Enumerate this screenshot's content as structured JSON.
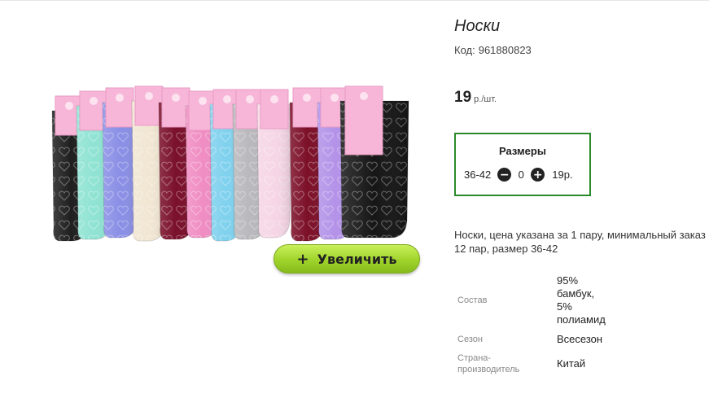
{
  "product": {
    "title": "Носки",
    "code_label": "Код:",
    "code_value": "961880823",
    "price_value": "19",
    "price_unit": "р./шт."
  },
  "sizes": {
    "heading": "Размеры",
    "size": "36-42",
    "minus_icon": "minus-circle-icon",
    "quantity": "0",
    "plus_icon": "plus-circle-icon",
    "price": "19р.",
    "border_color": "#2a8a2a"
  },
  "zoom_button": {
    "icon": "+",
    "label": "Увеличить",
    "color": "#9fd32b"
  },
  "description": "Носки, цена указана за 1 пару, минимальный заказ 12 пар, размер 36-42",
  "specs": {
    "composition_label": "Состав",
    "composition_value": [
      "95%",
      "бамбук,",
      "5%",
      "полиамид"
    ],
    "season_label": "Сезон",
    "season_value": "Всесезон",
    "country_label": [
      "Страна-",
      "производитель"
    ],
    "country_value": "Китай"
  }
}
